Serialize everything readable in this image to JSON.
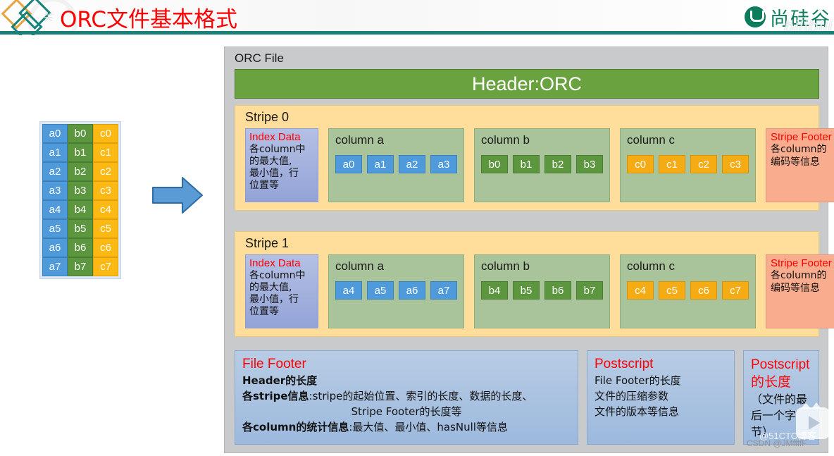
{
  "header": {
    "title": "ORC文件基本格式",
    "ghost_text": "· 关 ·",
    "brand_text": "尚硅谷",
    "brand_ghost": "bilibili",
    "accent_rule_color": "#1a7f77",
    "title_color": "#ff0000",
    "brand_color": "#0b7d5c"
  },
  "row_table": {
    "columns": [
      {
        "name": "a",
        "color": "#4f9ada",
        "cells": [
          "a0",
          "a1",
          "a2",
          "a3",
          "a4",
          "a5",
          "a6",
          "a7"
        ]
      },
      {
        "name": "b",
        "color": "#5c9740",
        "cells": [
          "b0",
          "b1",
          "b2",
          "b3",
          "b4",
          "b5",
          "b6",
          "b7"
        ]
      },
      {
        "name": "c",
        "color": "#fcb813",
        "cells": [
          "c0",
          "c1",
          "c2",
          "c3",
          "c4",
          "c5",
          "c6",
          "c7"
        ]
      }
    ]
  },
  "arrow": {
    "fill": "#5b9bd5",
    "stroke": "#2e6da4",
    "direction": "right"
  },
  "orc_file": {
    "label": "ORC File",
    "header_banner": "Header:ORC",
    "header_banner_color": "#6ba240",
    "stripes": [
      {
        "title": "Stripe 0",
        "index_data": {
          "title": "Index Data",
          "lines": [
            "各column中",
            "的最大值,",
            "最小值，行",
            "位置等"
          ]
        },
        "columns": [
          {
            "title": "column a",
            "cells": [
              "a0",
              "a1",
              "a2",
              "a3"
            ],
            "cell_class": "cell-a"
          },
          {
            "title": "column b",
            "cells": [
              "b0",
              "b1",
              "b2",
              "b3"
            ],
            "cell_class": "cell-b"
          },
          {
            "title": "column c",
            "cells": [
              "c0",
              "c1",
              "c2",
              "c3"
            ],
            "cell_class": "cell-c"
          }
        ],
        "stripe_footer": {
          "title": "Stripe Footer",
          "lines": [
            "各column的",
            "编码等信息"
          ]
        }
      },
      {
        "title": "Stripe 1",
        "index_data": {
          "title": "Index Data",
          "lines": [
            "各column中",
            "的最大值,",
            "最小值，行",
            "位置等"
          ]
        },
        "columns": [
          {
            "title": "column a",
            "cells": [
              "a4",
              "a5",
              "a6",
              "a7"
            ],
            "cell_class": "cell-a"
          },
          {
            "title": "column b",
            "cells": [
              "b4",
              "b5",
              "b6",
              "b7"
            ],
            "cell_class": "cell-b"
          },
          {
            "title": "column c",
            "cells": [
              "c4",
              "c5",
              "c6",
              "c7"
            ],
            "cell_class": "cell-c"
          }
        ],
        "stripe_footer": {
          "title": "Stripe Footer",
          "lines": [
            "各column的",
            "编码等信息"
          ]
        }
      }
    ],
    "file_footer": {
      "title": "File Footer",
      "line1": "Header的长度",
      "line2_lead": "各stripe信息",
      "line2_rest": ":stripe的起始位置、索引的长度、数据的长度、",
      "line3": "Stripe Footer的长度等",
      "line4_lead": "各column的统计信息",
      "line4_rest": ":最大值、最小值、hasNull等信息"
    },
    "postscript": {
      "title": "Postscript",
      "lines": [
        "File Footer的长度",
        "文件的压缩参数",
        "文件的版本等信息"
      ]
    },
    "postscript_length": {
      "title_line1": "Postscript",
      "title_line2": "的长度",
      "lines": [
        "（文件的最",
        "后一个字节）"
      ]
    }
  },
  "watermarks": {
    "play_icon": "play-button-icon",
    "site_51cto": "@51CTO博客",
    "csdn": "CSDN @JMffffF"
  }
}
